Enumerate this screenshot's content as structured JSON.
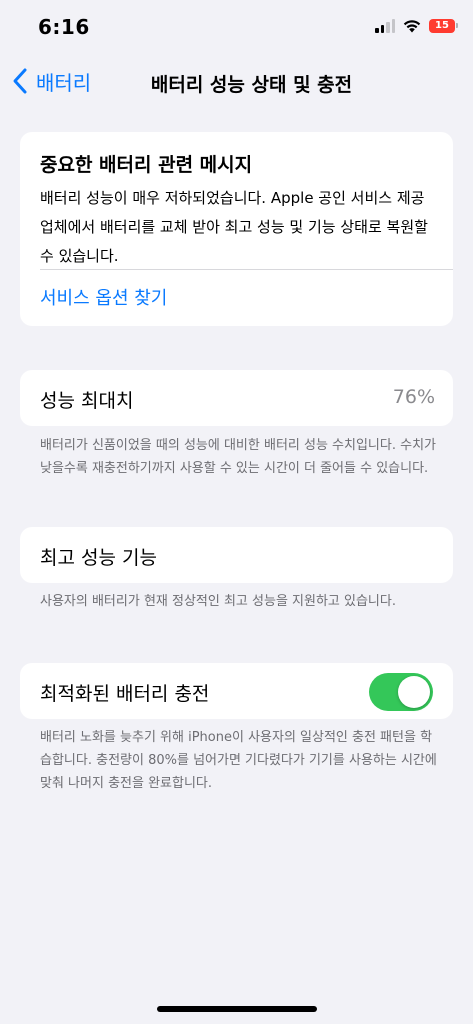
{
  "status_bar": {
    "time": "6:16",
    "battery_level": "15",
    "battery_color": "#ff3b30"
  },
  "nav": {
    "back_label": "배터리",
    "title": "배터리 성능 상태 및 충전"
  },
  "message_card": {
    "title": "중요한 배터리 관련 메시지",
    "body": "배터리 성능이 매우 저하되었습니다. Apple 공인 서비스 제공업체에서 배터리를 교체 받아 최고 성능 및 기능 상태로 복원할 수 있습니다.",
    "link": "서비스 옵션 찾기"
  },
  "max_capacity": {
    "label": "성능 최대치",
    "value": "76%",
    "footnote": "배터리가 신품이었을 때의 성능에 대비한 배터리 성능 수치입니다. 수치가 낮을수록 재충전하기까지 사용할 수 있는 시간이 더 줄어들 수 있습니다."
  },
  "peak_performance": {
    "label": "최고 성능 기능",
    "footnote": "사용자의 배터리가 현재 정상적인 최고 성능을 지원하고 있습니다."
  },
  "optimized_charging": {
    "label": "최적화된 배터리 충전",
    "enabled": true,
    "footnote": "배터리 노화를 늦추기 위해 iPhone이 사용자의 일상적인 충전 패턴을 학습합니다. 충전량이 80%를 넘어가면 기다렸다가 기기를 사용하는 시간에 맞춰 나머지 충전을 완료합니다."
  },
  "colors": {
    "accent": "#0a7aff",
    "toggle_on": "#34c759",
    "background": "#f2f2f7"
  }
}
